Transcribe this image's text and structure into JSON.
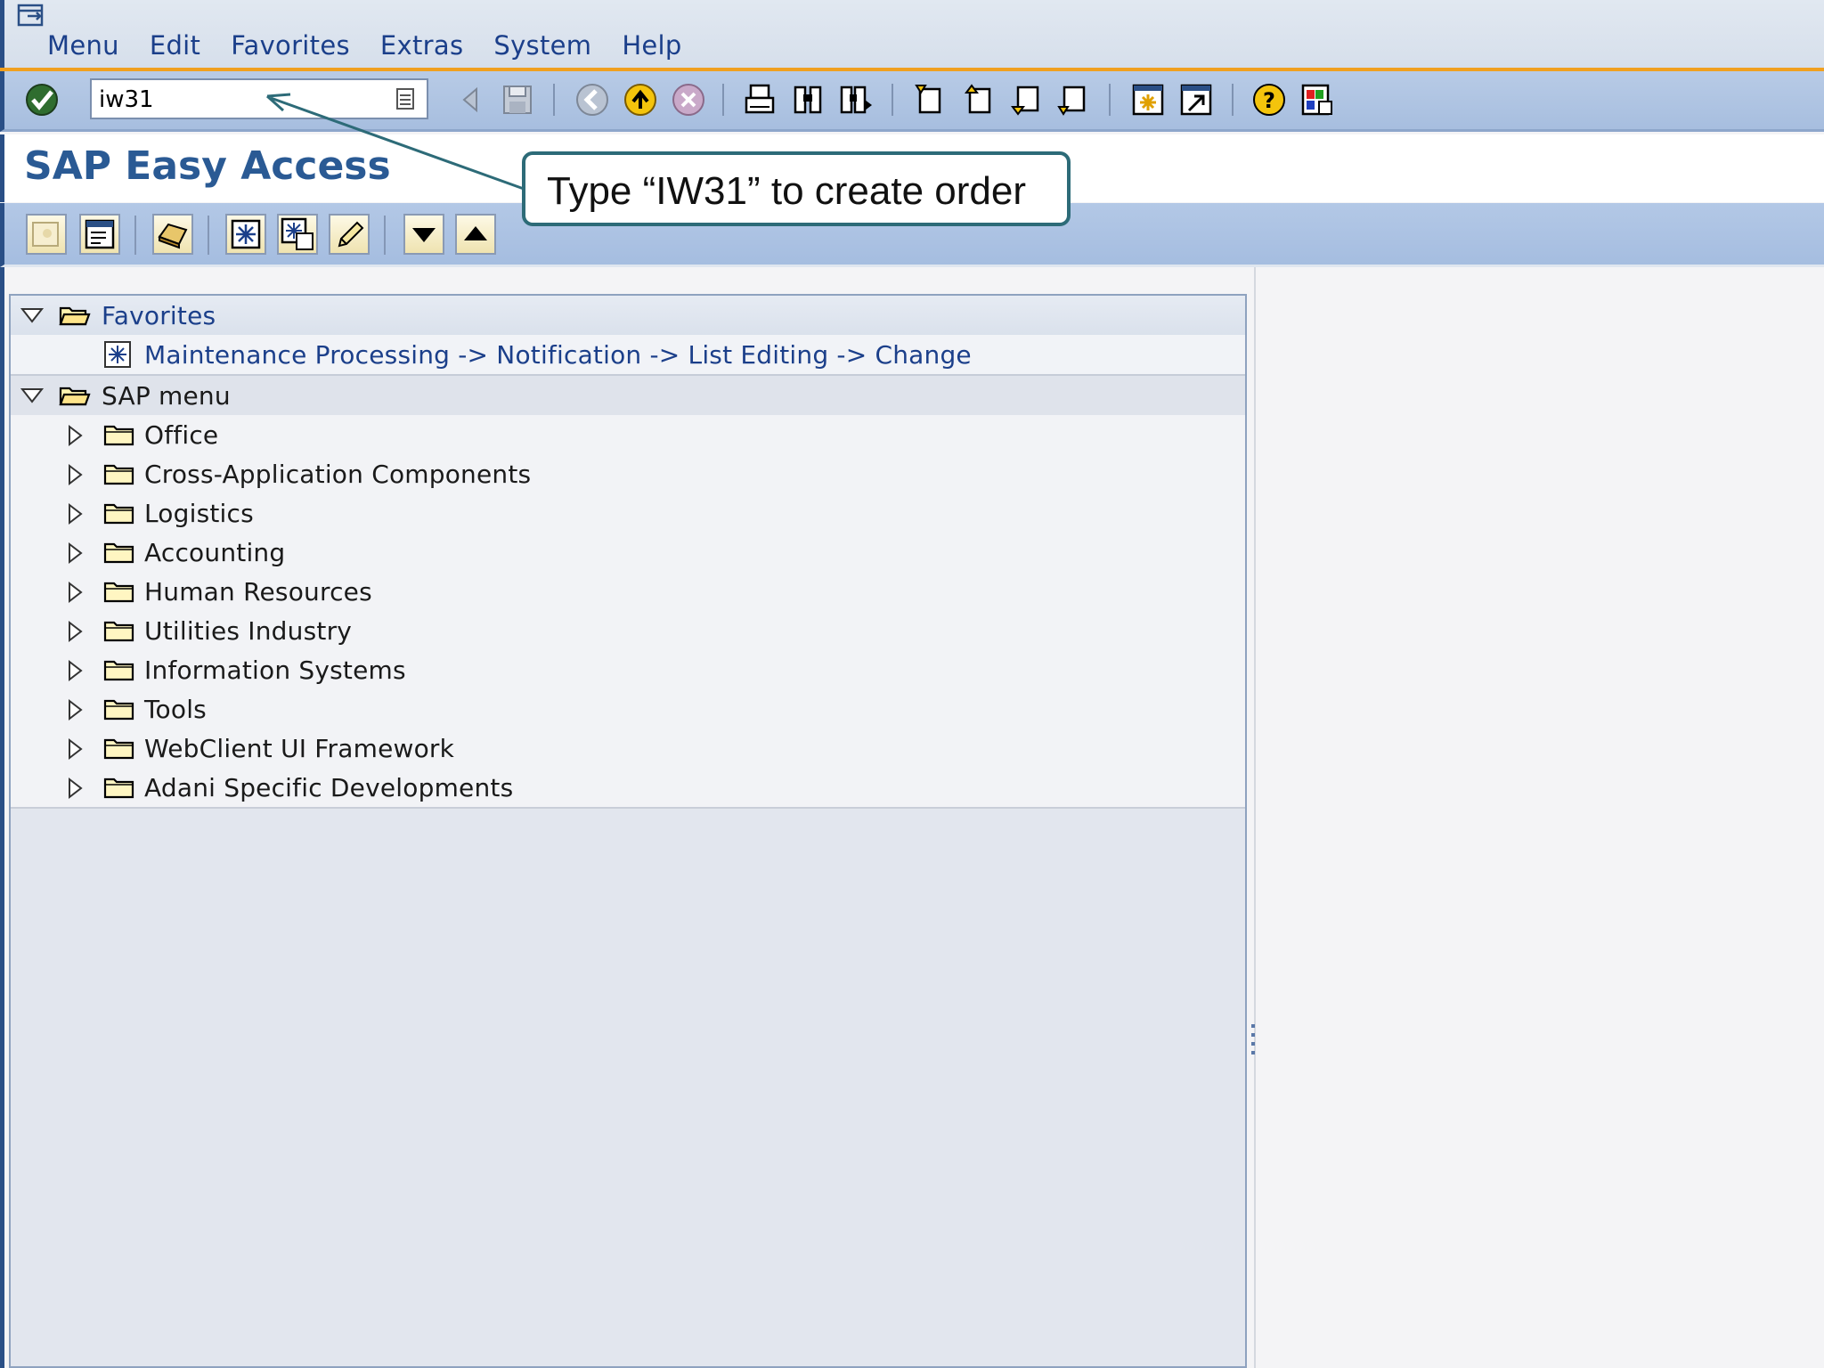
{
  "menubar": {
    "items": [
      {
        "label": "Menu",
        "u": "M"
      },
      {
        "label": "Edit",
        "u": "E"
      },
      {
        "label": "Favorites",
        "u": "F"
      },
      {
        "label": "Extras",
        "u": "x"
      },
      {
        "label": "System",
        "u": "S"
      },
      {
        "label": "Help",
        "u": "H"
      }
    ]
  },
  "toolbar": {
    "command_value": "iw31"
  },
  "page": {
    "title": "SAP Easy Access"
  },
  "callout": {
    "text": "Type “IW31” to create order"
  },
  "tree": {
    "favorites_label": "Favorites",
    "favorite_item": "Maintenance Processing -> Notification -> List Editing -> Change",
    "sap_menu_label": "SAP menu",
    "sap_items": [
      "Office",
      "Cross-Application Components",
      "Logistics",
      "Accounting",
      "Human Resources",
      "Utilities Industry",
      "Information Systems",
      "Tools",
      "WebClient UI Framework",
      "Adani Specific Developments"
    ]
  },
  "colors": {
    "accent": "#f0a020",
    "title_blue": "#2a5a94",
    "link_blue": "#1b3f8a",
    "callout_border": "#2d6b78"
  }
}
